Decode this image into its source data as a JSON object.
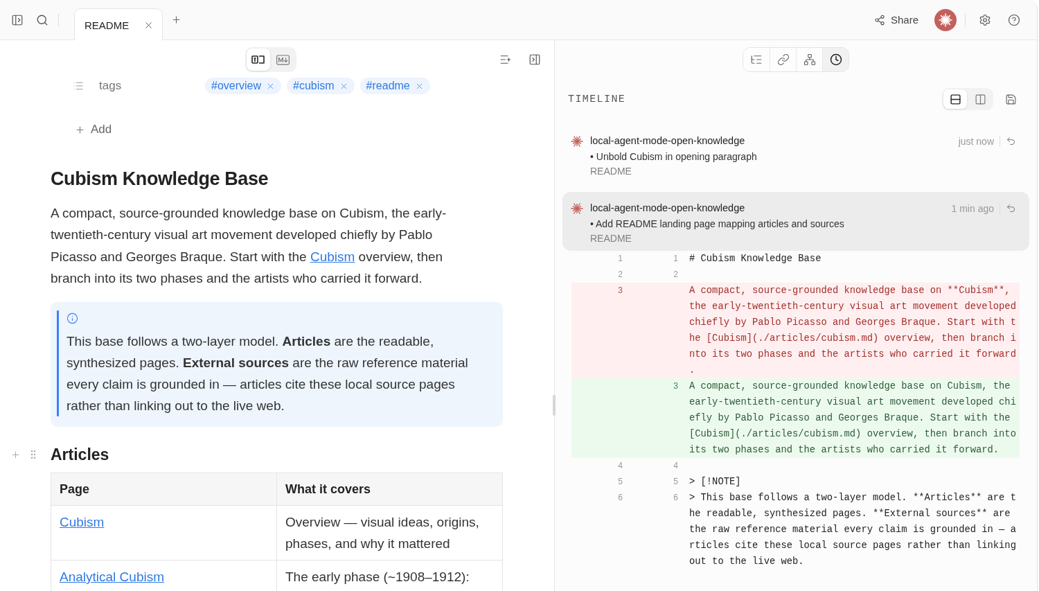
{
  "top_bar": {
    "tabs": [
      {
        "label": "README",
        "selected": true
      }
    ],
    "share": {
      "label": "Share"
    }
  },
  "editor": {
    "view_modes": [
      {
        "kind": "rich",
        "selected": true
      },
      {
        "kind": "markdown",
        "selected": false
      }
    ],
    "properties": [
      {
        "name": "tags",
        "values": [
          "#overview",
          "#cubism",
          "#readme"
        ]
      }
    ],
    "add_property": {
      "label": "Add"
    },
    "title": "Cubism Knowledge Base",
    "intro": {
      "before": "A compact, source-grounded knowledge base on Cubism, the early-twentieth-century visual art movement developed chiefly by Pablo Picasso and Georges Braque. Start with the ",
      "link": "Cubism",
      "after": " overview, then branch into its two phases and the artists who carried it forward."
    },
    "note": {
      "text": "This base follows a two-layer model. **Articles** are the readable, synthesized pages. **External sources** are the raw reference material every claim is grounded in — articles cite these local source pages rather than linking out to the live web."
    },
    "articles": {
      "heading": "Articles",
      "columns": [
        "Page",
        "What it covers"
      ],
      "rows": [
        {
          "page": "Cubism",
          "covers": "Overview — visual ideas, origins, phases, and why it mattered"
        },
        {
          "page": "Analytical Cubism",
          "covers": "The early phase (~1908–1912):"
        }
      ]
    }
  },
  "side_panel": {
    "tools": [
      {
        "kind": "outline",
        "selected": false
      },
      {
        "kind": "links",
        "selected": false
      },
      {
        "kind": "graph",
        "selected": false
      },
      {
        "kind": "history",
        "selected": true
      }
    ],
    "title": "TIMELINE",
    "layouts": [
      {
        "kind": "stacked",
        "selected": true
      },
      {
        "kind": "split",
        "selected": false
      }
    ],
    "entries": [
      {
        "author": "local-agent-mode-open-knowledge",
        "time": "just now",
        "change": "• Unbold Cubism in opening paragraph",
        "file": "README",
        "selected": false
      },
      {
        "author": "local-agent-mode-open-knowledge",
        "time": "1 min ago",
        "change": "• Add README landing page mapping articles and sources",
        "file": "README",
        "selected": true
      }
    ],
    "diff": {
      "lines": [
        {
          "kind": "context",
          "old": "1",
          "new": "1",
          "text": "# Cubism Knowledge Base"
        },
        {
          "kind": "context",
          "old": "2",
          "new": "2"
        },
        {
          "kind": "removed",
          "old": "3",
          "text": "A compact, source-grounded knowledge base on **Cubism**, the early-twentieth-century visual art movement developed chiefly by Pablo Picasso and Georges Braque. Start with the [Cubism](./articles/cubism.md) overview, then branch into its two phases and the artists who carried it forward."
        },
        {
          "kind": "added",
          "new": "3",
          "text": "A compact, source-grounded knowledge base on Cubism, the early-twentieth-century visual art movement developed chiefly by Pablo Picasso and Georges Braque. Start with the [Cubism](./articles/cubism.md) overview, then branch into its two phases and the artists who carried it forward."
        },
        {
          "kind": "context",
          "old": "4",
          "new": "4"
        },
        {
          "kind": "context",
          "old": "5",
          "new": "5",
          "text": "> [!NOTE]"
        },
        {
          "kind": "context",
          "old": "6",
          "new": "6",
          "text": "> This base follows a two-layer model. **Articles** are the readable, synthesized pages. **External sources** are the raw reference material every claim is grounded in — articles cite these local source pages rather than linking out to the live web."
        }
      ]
    }
  }
}
